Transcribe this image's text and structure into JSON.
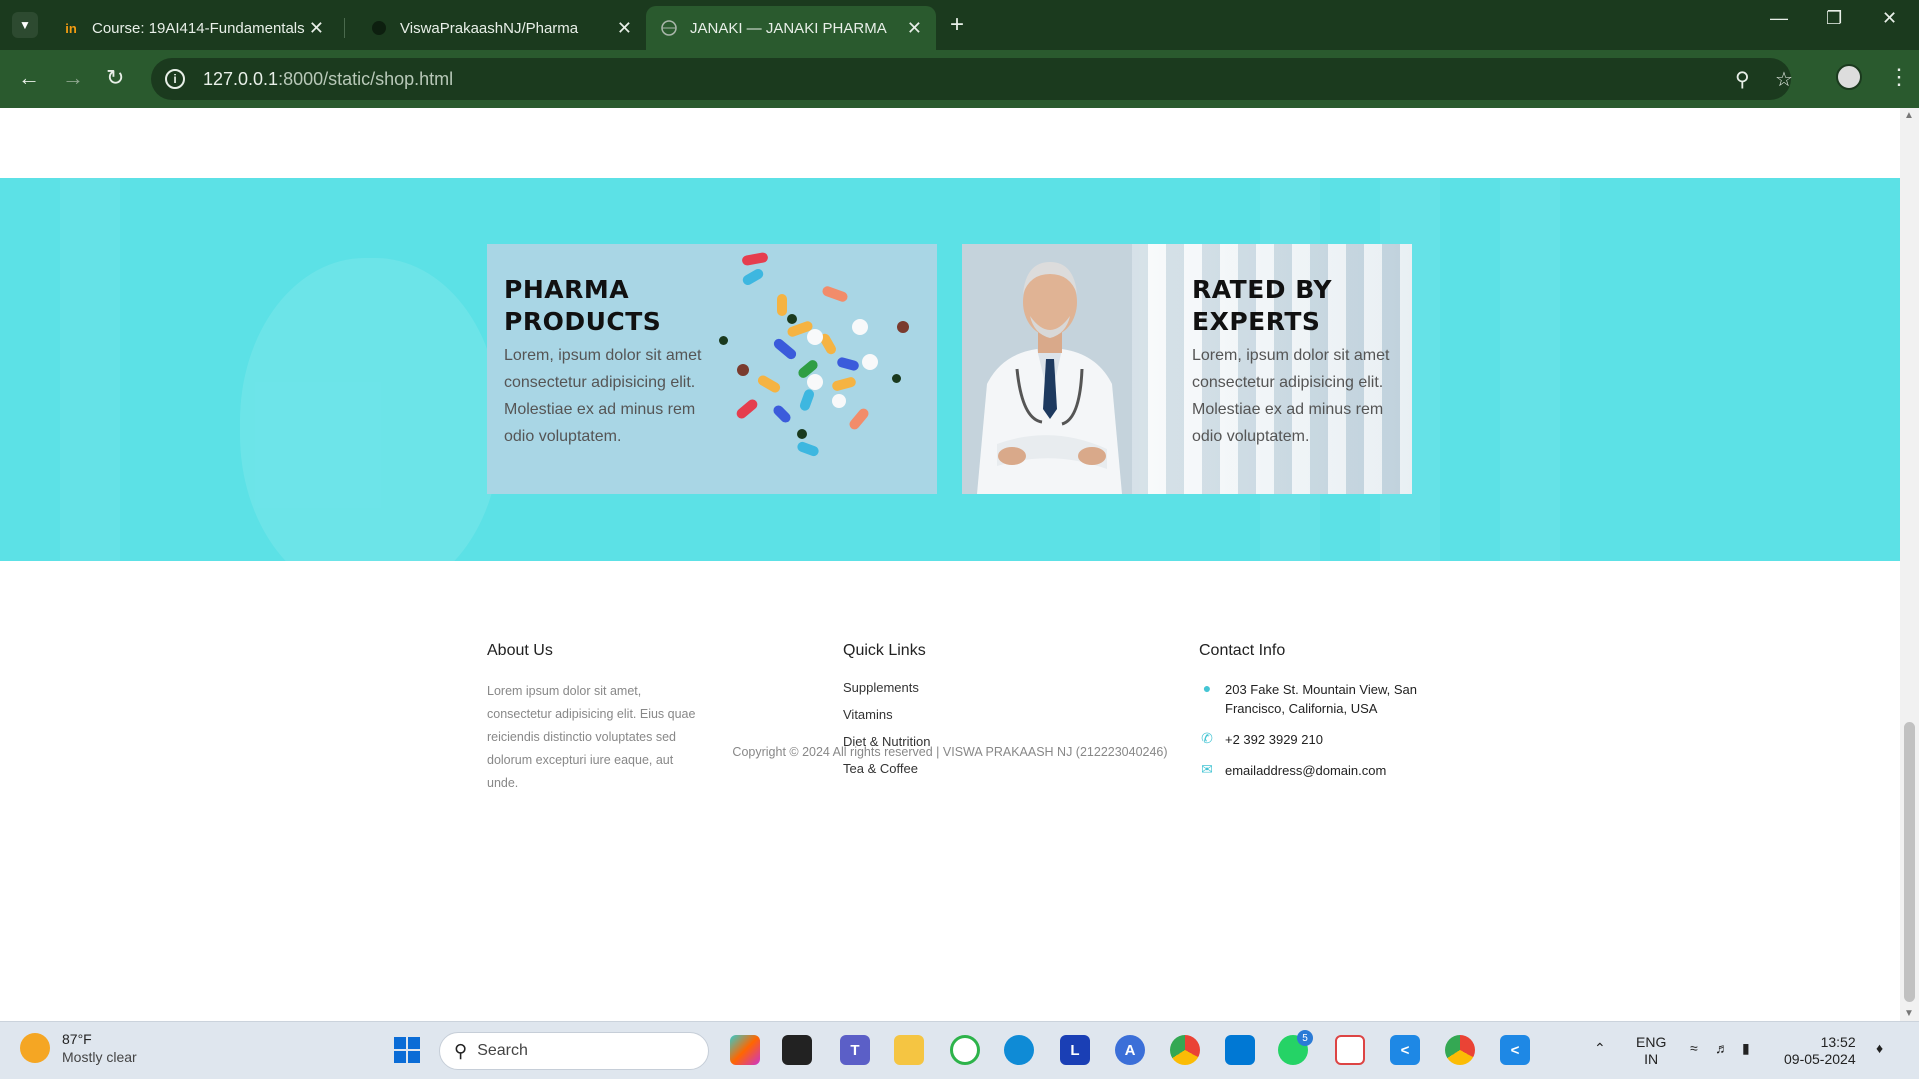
{
  "browser": {
    "tabs": [
      {
        "title": "Course: 19AI414-Fundamentals",
        "favicon": "in",
        "active": false
      },
      {
        "title": "ViswaPrakaashNJ/Pharma",
        "favicon": "github-icon",
        "active": false
      },
      {
        "title": "JANAKI — JANAKI PHARMA",
        "favicon": "globe-icon",
        "active": true
      }
    ],
    "url_host": "127.0.0.1",
    "url_path": ":8000/static/shop.html"
  },
  "hero": {
    "cards": [
      {
        "title_line1": "PHARMA",
        "title_line2": "PRODUCTS",
        "text": "Lorem, ipsum dolor sit amet consectetur adipisicing elit. Molestiae ex ad minus rem odio voluptatem."
      },
      {
        "title_line1": "RATED BY",
        "title_line2": "EXPERTS",
        "text": "Lorem, ipsum dolor sit amet consectetur adipisicing elit. Molestiae ex ad minus rem odio voluptatem."
      }
    ],
    "accent_color": "#5ce1e6"
  },
  "footer": {
    "about": {
      "heading": "About Us",
      "text": "Lorem ipsum dolor sit amet, consectetur adipisicing elit. Eius quae reiciendis distinctio voluptates sed dolorum excepturi iure eaque, aut unde."
    },
    "quick_links": {
      "heading": "Quick Links",
      "items": [
        "Supplements",
        "Vitamins",
        "Diet & Nutrition",
        "Tea & Coffee"
      ]
    },
    "contact": {
      "heading": "Contact Info",
      "address": "203 Fake St. Mountain View, San Francisco, California, USA",
      "phone": "+2 392 3929 210",
      "email": "emailaddress@domain.com"
    },
    "copyright": "Copyright © 2024 All rights reserved | VISWA PRAKAASH NJ (212223040246)"
  },
  "taskbar": {
    "weather_temp": "87°F",
    "weather_condition": "Mostly clear",
    "search_label": "Search",
    "whatsapp_badge": "5",
    "lang": "ENG",
    "region": "IN",
    "time": "13:52",
    "date": "09-05-2024"
  }
}
